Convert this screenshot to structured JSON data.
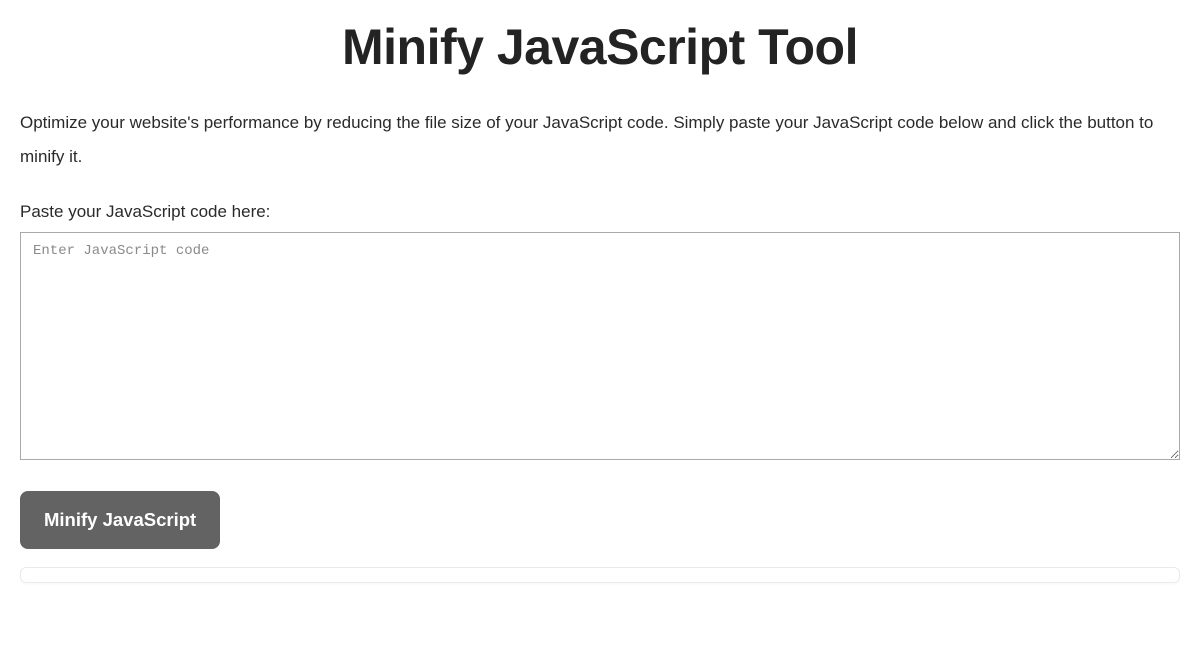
{
  "header": {
    "title": "Minify JavaScript Tool"
  },
  "main": {
    "description": "Optimize your website's performance by reducing the file size of your JavaScript code. Simply paste your JavaScript code below and click the button to minify it.",
    "input_label": "Paste your JavaScript code here:",
    "input_placeholder": "Enter JavaScript code",
    "input_value": "",
    "button_label": "Minify JavaScript"
  }
}
